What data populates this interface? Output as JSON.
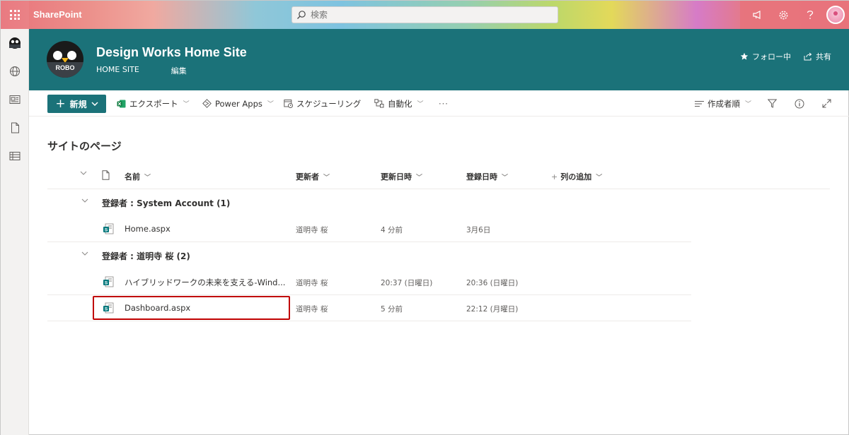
{
  "suitebar": {
    "brand": "SharePoint",
    "search_placeholder": "検索",
    "icons": [
      "waffle-icon",
      "megaphone-icon",
      "gear-icon",
      "help-icon",
      "avatar"
    ]
  },
  "site": {
    "logo_text": "ROBO",
    "title": "Design Works Home Site",
    "nav": [
      "HOME SITE",
      "編集"
    ],
    "follow_label": "フォロー中",
    "share_label": "共有"
  },
  "commandbar": {
    "new_label": "新規",
    "export_label": "エクスポート",
    "powerapps_label": "Power Apps",
    "schedule_label": "スケジューリング",
    "automate_label": "自動化",
    "more_label": "···",
    "sort_label": "作成者順"
  },
  "page": {
    "heading": "サイトのページ"
  },
  "list": {
    "columns": {
      "name": "名前",
      "modified_by": "更新者",
      "modified": "更新日時",
      "created": "登録日時",
      "add_column": "列の追加"
    },
    "groups": [
      {
        "label": "登録者 : System Account (1)",
        "rows": [
          {
            "name": "Home.aspx",
            "modified_by": "道明寺 桜",
            "modified": "4 分前",
            "created": "3月6日"
          }
        ]
      },
      {
        "label": "登録者 : 道明寺 桜 (2)",
        "rows": [
          {
            "name": "ハイブリッドワークの未来を支える-Wind...",
            "modified_by": "道明寺 桜",
            "modified": "20:37 (日曜日)",
            "created": "20:36 (日曜日)"
          },
          {
            "name": "Dashboard.aspx",
            "modified_by": "道明寺 桜",
            "modified": "5 分前",
            "created": "22:12 (月曜日)"
          }
        ]
      }
    ]
  },
  "colors": {
    "accent": "#1b7279",
    "highlight": "#c00000"
  }
}
